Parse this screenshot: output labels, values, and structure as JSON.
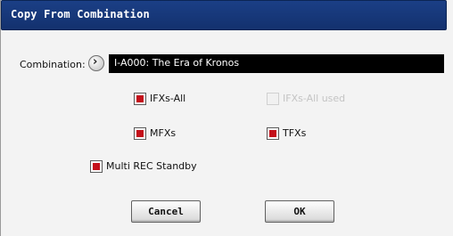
{
  "dialog": {
    "title": "Copy From Combination"
  },
  "combination": {
    "label": "Combination:",
    "value": "I-A000: The Era of Kronos",
    "arrow": "chevron-right-icon"
  },
  "options": {
    "ifxs_all": {
      "label": "IFXs-All",
      "checked": true
    },
    "ifxs_all_used": {
      "label": "IFXs-All used",
      "checked": false,
      "disabled": true
    },
    "mfxs": {
      "label": "MFXs",
      "checked": true
    },
    "tfxs": {
      "label": "TFXs",
      "checked": true
    },
    "multi_rec_standby": {
      "label": "Multi REC Standby",
      "checked": true
    }
  },
  "buttons": {
    "cancel": "Cancel",
    "ok": "OK"
  },
  "colors": {
    "title_bar": "#173a7c",
    "check_mark": "#c4101a",
    "field_bg": "#000000"
  }
}
